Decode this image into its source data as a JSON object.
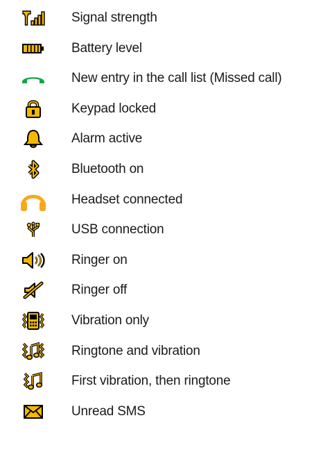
{
  "legend": {
    "items": [
      {
        "icon": "signal-strength-icon",
        "label": "Signal strength"
      },
      {
        "icon": "battery-level-icon",
        "label": "Battery level"
      },
      {
        "icon": "missed-call-icon",
        "label": "New entry in the call list (Missed call)"
      },
      {
        "icon": "keypad-lock-icon",
        "label": "Keypad locked"
      },
      {
        "icon": "alarm-bell-icon",
        "label": "Alarm active"
      },
      {
        "icon": "bluetooth-icon",
        "label": "Bluetooth on"
      },
      {
        "icon": "headset-icon",
        "label": "Headset connected"
      },
      {
        "icon": "usb-icon",
        "label": "USB connection"
      },
      {
        "icon": "ringer-on-icon",
        "label": "Ringer on"
      },
      {
        "icon": "ringer-off-icon",
        "label": "Ringer off"
      },
      {
        "icon": "vibration-icon",
        "label": "Vibration only"
      },
      {
        "icon": "ringtone-vibration-icon",
        "label": "Ringtone and vibration"
      },
      {
        "icon": "vibration-then-ringtone-icon",
        "label": "First vibration, then ringtone"
      },
      {
        "icon": "envelope-icon",
        "label": "Unread SMS"
      }
    ]
  },
  "colors": {
    "icon_fill": "#f5b700",
    "icon_outline": "#000000",
    "missed_call": "#17a548",
    "headset": "#f7a81b",
    "text": "#1a1a1a"
  }
}
